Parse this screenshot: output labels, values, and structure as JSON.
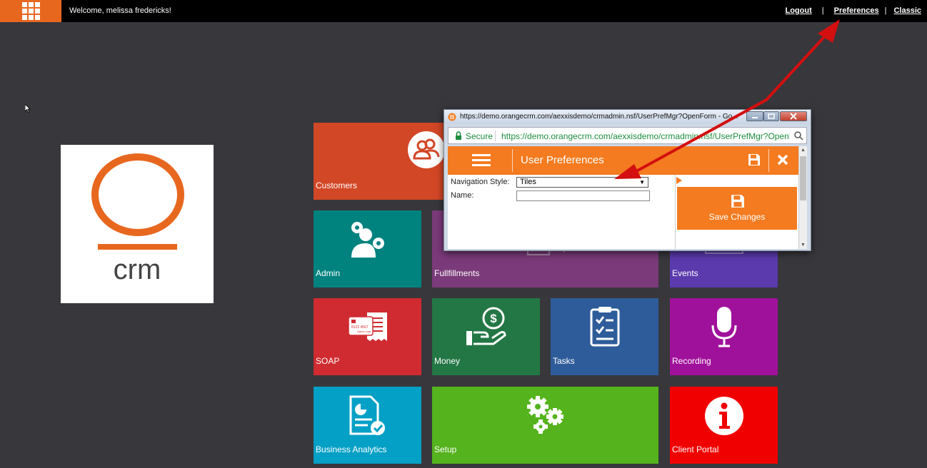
{
  "topbar": {
    "welcome": "Welcome, melissa fredericks!",
    "links": {
      "logout": "Logout",
      "preferences": "Preferences",
      "classic": "Classic"
    },
    "separator": "|"
  },
  "logo": {
    "text": "crm",
    "accent": "#e8671f"
  },
  "tiles": [
    {
      "label": "Customers",
      "color": "#d24726",
      "icon": "people-icon"
    },
    {
      "label": "Admin",
      "color": "#00827f",
      "icon": "admin-gears-icon"
    },
    {
      "label": "Fullfillments",
      "color": "#7b3a7a",
      "icon": "truck-icon"
    },
    {
      "label": "Events",
      "color": "#5a3aad",
      "icon": "calendar-icon"
    },
    {
      "label": "SOAP",
      "color": "#cf2b30",
      "icon": "card-receipt-icon",
      "card_text": "8123 4567",
      "card_subtext": "Name Last"
    },
    {
      "label": "Money",
      "color": "#237744",
      "icon": "money-hand-icon"
    },
    {
      "label": "Tasks",
      "color": "#2e5c9a",
      "icon": "clipboard-icon"
    },
    {
      "label": "Recording",
      "color": "#a0119b",
      "icon": "microphone-icon"
    },
    {
      "label": "Business Analytics",
      "color": "#05a0c5",
      "icon": "report-icon"
    },
    {
      "label": "Setup",
      "color": "#55b31d",
      "icon": "gears-icon"
    },
    {
      "label": "Client Portal",
      "color": "#f10000",
      "icon": "info-icon"
    }
  ],
  "popup": {
    "window_title": "https://demo.orangecrm.com/aexxisdemo/crmadmin.nsf/UserPrefMgr?OpenForm - Go...",
    "secure_label": "Secure",
    "url": "https://demo.orangecrm.com/aexxisdemo/crmadmin.nsf/UserPrefMgr?OpenForm",
    "header_title": "User Preferences",
    "fields": {
      "navigation_style_label": "Navigation Style:",
      "navigation_style_value": "Tiles",
      "name_label": "Name:",
      "name_value": ""
    },
    "save_changes_label": "Save Changes"
  },
  "colors": {
    "orange": "#f47b20",
    "annotation_arrow": "#d40f0f",
    "background": "#38373c"
  }
}
